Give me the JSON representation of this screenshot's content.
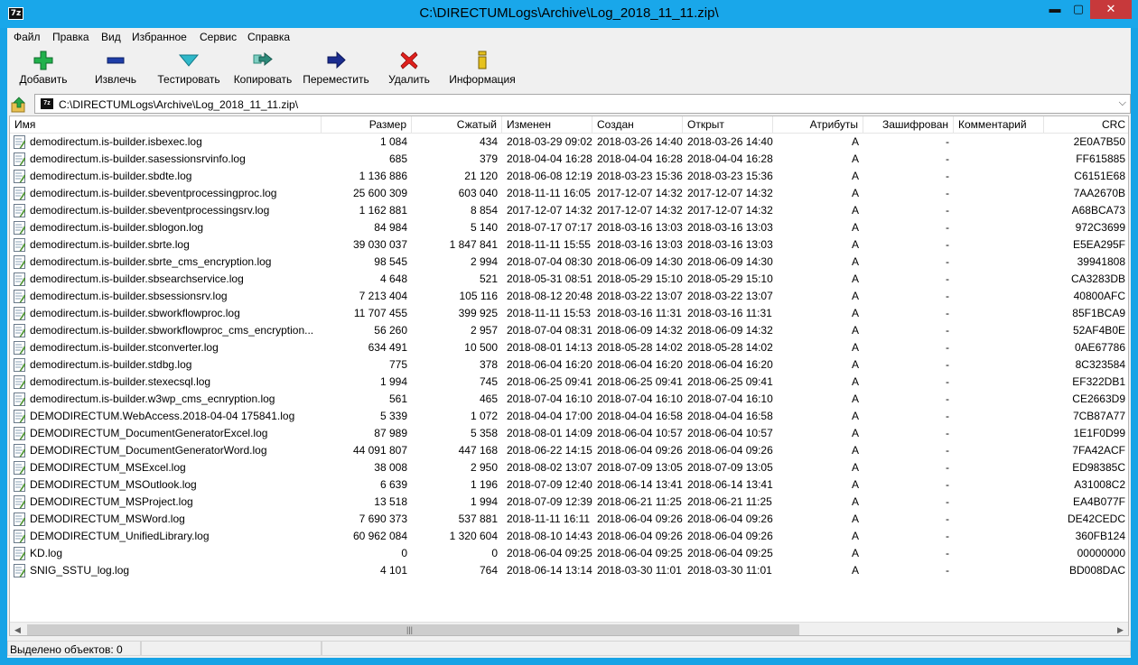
{
  "window": {
    "title": "C:\\DIRECTUMLogs\\Archive\\Log_2018_11_11.zip\\",
    "min": "▬",
    "max": "▢",
    "close": "✕"
  },
  "menu": [
    "Файл",
    "Правка",
    "Вид",
    "Избранное",
    "Сервис",
    "Справка"
  ],
  "toolbar": {
    "add": "Добавить",
    "extract": "Извлечь",
    "test": "Тестировать",
    "copy": "Копировать",
    "move": "Переместить",
    "delete": "Удалить",
    "info": "Информация"
  },
  "address": {
    "path": "C:\\DIRECTUMLogs\\Archive\\Log_2018_11_11.zip\\"
  },
  "columns": {
    "name": "Имя",
    "size": "Размер",
    "packed": "Сжатый",
    "modified": "Изменен",
    "created": "Создан",
    "accessed": "Открыт",
    "attributes": "Атрибуты",
    "encrypted": "Зашифрован",
    "comment": "Комментарий",
    "crc": "CRC"
  },
  "files": [
    {
      "name": "demodirectum.is-builder.isbexec.log",
      "size": "1 084",
      "packed": "434",
      "modified": "2018-03-29 09:02",
      "created": "2018-03-26 14:40",
      "accessed": "2018-03-26 14:40",
      "attr": "A",
      "enc": "-",
      "comment": "",
      "crc": "2E0A7B50"
    },
    {
      "name": "demodirectum.is-builder.sasessionsrvinfo.log",
      "size": "685",
      "packed": "379",
      "modified": "2018-04-04 16:28",
      "created": "2018-04-04 16:28",
      "accessed": "2018-04-04 16:28",
      "attr": "A",
      "enc": "-",
      "comment": "",
      "crc": "FF615885"
    },
    {
      "name": "demodirectum.is-builder.sbdte.log",
      "size": "1 136 886",
      "packed": "21 120",
      "modified": "2018-06-08 12:19",
      "created": "2018-03-23 15:36",
      "accessed": "2018-03-23 15:36",
      "attr": "A",
      "enc": "-",
      "comment": "",
      "crc": "C6151E68"
    },
    {
      "name": "demodirectum.is-builder.sbeventprocessingproc.log",
      "size": "25 600 309",
      "packed": "603 040",
      "modified": "2018-11-11 16:05",
      "created": "2017-12-07 14:32",
      "accessed": "2017-12-07 14:32",
      "attr": "A",
      "enc": "-",
      "comment": "",
      "crc": "7AA2670B"
    },
    {
      "name": "demodirectum.is-builder.sbeventprocessingsrv.log",
      "size": "1 162 881",
      "packed": "8 854",
      "modified": "2017-12-07 14:32",
      "created": "2017-12-07 14:32",
      "accessed": "2017-12-07 14:32",
      "attr": "A",
      "enc": "-",
      "comment": "",
      "crc": "A68BCA73"
    },
    {
      "name": "demodirectum.is-builder.sblogon.log",
      "size": "84 984",
      "packed": "5 140",
      "modified": "2018-07-17 07:17",
      "created": "2018-03-16 13:03",
      "accessed": "2018-03-16 13:03",
      "attr": "A",
      "enc": "-",
      "comment": "",
      "crc": "972C3699"
    },
    {
      "name": "demodirectum.is-builder.sbrte.log",
      "size": "39 030 037",
      "packed": "1 847 841",
      "modified": "2018-11-11 15:55",
      "created": "2018-03-16 13:03",
      "accessed": "2018-03-16 13:03",
      "attr": "A",
      "enc": "-",
      "comment": "",
      "crc": "E5EA295F"
    },
    {
      "name": "demodirectum.is-builder.sbrte_cms_encryption.log",
      "size": "98 545",
      "packed": "2 994",
      "modified": "2018-07-04 08:30",
      "created": "2018-06-09 14:30",
      "accessed": "2018-06-09 14:30",
      "attr": "A",
      "enc": "-",
      "comment": "",
      "crc": "39941808"
    },
    {
      "name": "demodirectum.is-builder.sbsearchservice.log",
      "size": "4 648",
      "packed": "521",
      "modified": "2018-05-31 08:51",
      "created": "2018-05-29 15:10",
      "accessed": "2018-05-29 15:10",
      "attr": "A",
      "enc": "-",
      "comment": "",
      "crc": "CA3283DB"
    },
    {
      "name": "demodirectum.is-builder.sbsessionsrv.log",
      "size": "7 213 404",
      "packed": "105 116",
      "modified": "2018-08-12 20:48",
      "created": "2018-03-22 13:07",
      "accessed": "2018-03-22 13:07",
      "attr": "A",
      "enc": "-",
      "comment": "",
      "crc": "40800AFC"
    },
    {
      "name": "demodirectum.is-builder.sbworkflowproc.log",
      "size": "11 707 455",
      "packed": "399 925",
      "modified": "2018-11-11 15:53",
      "created": "2018-03-16 11:31",
      "accessed": "2018-03-16 11:31",
      "attr": "A",
      "enc": "-",
      "comment": "",
      "crc": "85F1BCA9"
    },
    {
      "name": "demodirectum.is-builder.sbworkflowproc_cms_encryption...",
      "size": "56 260",
      "packed": "2 957",
      "modified": "2018-07-04 08:31",
      "created": "2018-06-09 14:32",
      "accessed": "2018-06-09 14:32",
      "attr": "A",
      "enc": "-",
      "comment": "",
      "crc": "52AF4B0E"
    },
    {
      "name": "demodirectum.is-builder.stconverter.log",
      "size": "634 491",
      "packed": "10 500",
      "modified": "2018-08-01 14:13",
      "created": "2018-05-28 14:02",
      "accessed": "2018-05-28 14:02",
      "attr": "A",
      "enc": "-",
      "comment": "",
      "crc": "0AE67786"
    },
    {
      "name": "demodirectum.is-builder.stdbg.log",
      "size": "775",
      "packed": "378",
      "modified": "2018-06-04 16:20",
      "created": "2018-06-04 16:20",
      "accessed": "2018-06-04 16:20",
      "attr": "A",
      "enc": "-",
      "comment": "",
      "crc": "8C323584"
    },
    {
      "name": "demodirectum.is-builder.stexecsql.log",
      "size": "1 994",
      "packed": "745",
      "modified": "2018-06-25 09:41",
      "created": "2018-06-25 09:41",
      "accessed": "2018-06-25 09:41",
      "attr": "A",
      "enc": "-",
      "comment": "",
      "crc": "EF322DB1"
    },
    {
      "name": "demodirectum.is-builder.w3wp_cms_ecnryption.log",
      "size": "561",
      "packed": "465",
      "modified": "2018-07-04 16:10",
      "created": "2018-07-04 16:10",
      "accessed": "2018-07-04 16:10",
      "attr": "A",
      "enc": "-",
      "comment": "",
      "crc": "CE2663D9"
    },
    {
      "name": "DEMODIRECTUM.WebAccess.2018-04-04 175841.log",
      "size": "5 339",
      "packed": "1 072",
      "modified": "2018-04-04 17:00",
      "created": "2018-04-04 16:58",
      "accessed": "2018-04-04 16:58",
      "attr": "A",
      "enc": "-",
      "comment": "",
      "crc": "7CB87A77"
    },
    {
      "name": "DEMODIRECTUM_DocumentGeneratorExcel.log",
      "size": "87 989",
      "packed": "5 358",
      "modified": "2018-08-01 14:09",
      "created": "2018-06-04 10:57",
      "accessed": "2018-06-04 10:57",
      "attr": "A",
      "enc": "-",
      "comment": "",
      "crc": "1E1F0D99"
    },
    {
      "name": "DEMODIRECTUM_DocumentGeneratorWord.log",
      "size": "44 091 807",
      "packed": "447 168",
      "modified": "2018-06-22 14:15",
      "created": "2018-06-04 09:26",
      "accessed": "2018-06-04 09:26",
      "attr": "A",
      "enc": "-",
      "comment": "",
      "crc": "7FA42ACF"
    },
    {
      "name": "DEMODIRECTUM_MSExcel.log",
      "size": "38 008",
      "packed": "2 950",
      "modified": "2018-08-02 13:07",
      "created": "2018-07-09 13:05",
      "accessed": "2018-07-09 13:05",
      "attr": "A",
      "enc": "-",
      "comment": "",
      "crc": "ED98385C"
    },
    {
      "name": "DEMODIRECTUM_MSOutlook.log",
      "size": "6 639",
      "packed": "1 196",
      "modified": "2018-07-09 12:40",
      "created": "2018-06-14 13:41",
      "accessed": "2018-06-14 13:41",
      "attr": "A",
      "enc": "-",
      "comment": "",
      "crc": "A31008C2"
    },
    {
      "name": "DEMODIRECTUM_MSProject.log",
      "size": "13 518",
      "packed": "1 994",
      "modified": "2018-07-09 12:39",
      "created": "2018-06-21 11:25",
      "accessed": "2018-06-21 11:25",
      "attr": "A",
      "enc": "-",
      "comment": "",
      "crc": "EA4B077F"
    },
    {
      "name": "DEMODIRECTUM_MSWord.log",
      "size": "7 690 373",
      "packed": "537 881",
      "modified": "2018-11-11 16:11",
      "created": "2018-06-04 09:26",
      "accessed": "2018-06-04 09:26",
      "attr": "A",
      "enc": "-",
      "comment": "",
      "crc": "DE42CEDC"
    },
    {
      "name": "DEMODIRECTUM_UnifiedLibrary.log",
      "size": "60 962 084",
      "packed": "1 320 604",
      "modified": "2018-08-10 14:43",
      "created": "2018-06-04 09:26",
      "accessed": "2018-06-04 09:26",
      "attr": "A",
      "enc": "-",
      "comment": "",
      "crc": "360FB124"
    },
    {
      "name": "KD.log",
      "size": "0",
      "packed": "0",
      "modified": "2018-06-04 09:25",
      "created": "2018-06-04 09:25",
      "accessed": "2018-06-04 09:25",
      "attr": "A",
      "enc": "-",
      "comment": "",
      "crc": "00000000"
    },
    {
      "name": "SNIG_SSTU_log.log",
      "size": "4 101",
      "packed": "764",
      "modified": "2018-06-14 13:14",
      "created": "2018-03-30 11:01",
      "accessed": "2018-03-30 11:01",
      "attr": "A",
      "enc": "-",
      "comment": "",
      "crc": "BD008DAC"
    }
  ],
  "status": {
    "selected": "Выделено объектов: 0"
  },
  "colors": {
    "titlebar": "#19a7ea",
    "close_button": "#c7393b",
    "add_icon": "#22b14c",
    "extract_icon": "#1e3ea8",
    "test_icon": "#2fb8c9",
    "copy_icon": "#2c8a7a",
    "move_icon": "#1b2c8f",
    "delete_icon": "#e0201c",
    "info_icon": "#e6c21e"
  }
}
